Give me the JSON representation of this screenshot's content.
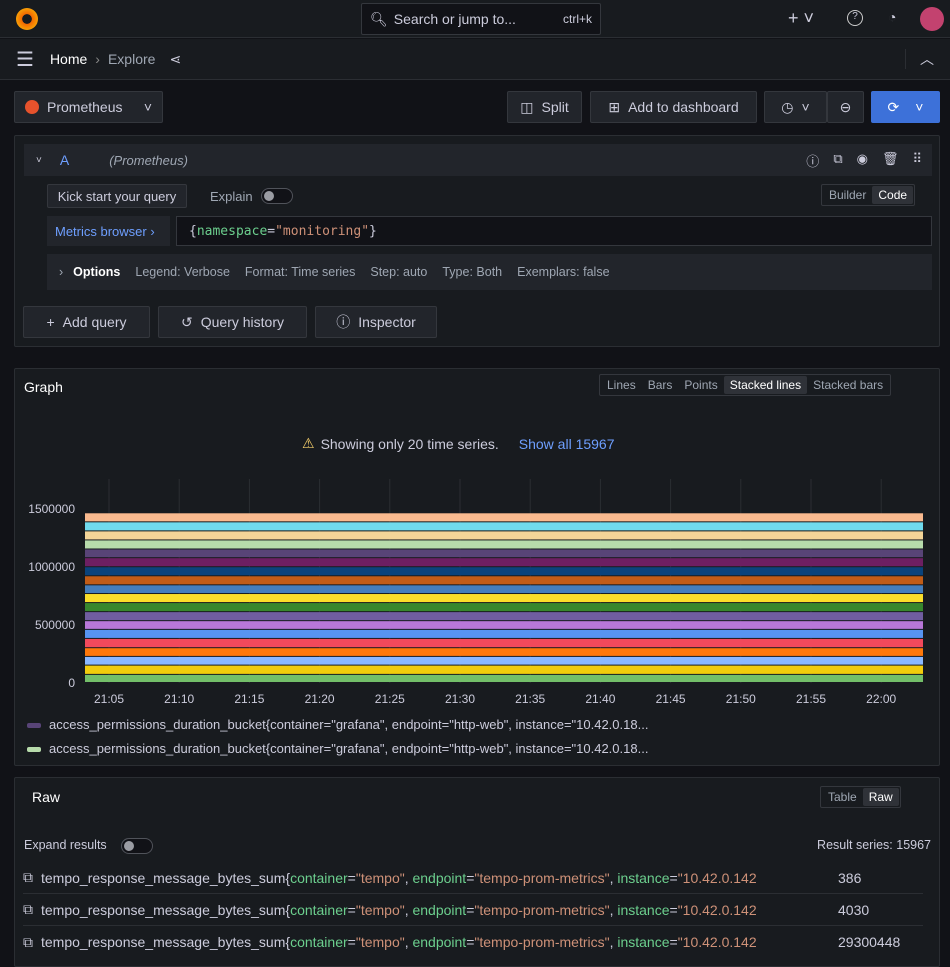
{
  "topbar": {
    "search_placeholder": "Search or jump to...",
    "shortcut": "ctrl+k"
  },
  "breadcrumb": {
    "home": "Home",
    "current": "Explore"
  },
  "toolbar": {
    "datasource": "Prometheus",
    "split": "Split",
    "add_to_dashboard": "Add to dashboard"
  },
  "query": {
    "ref": "A",
    "datasource": "(Prometheus)",
    "kick_start": "Kick start your query",
    "explain": "Explain",
    "builder": "Builder",
    "code": "Code",
    "metrics_browser": "Metrics browser",
    "expr_open": "{",
    "expr_key": "namespace",
    "expr_eq": "=",
    "expr_val": "\"monitoring\"",
    "expr_close": "}",
    "options": {
      "label": "Options",
      "legend": "Legend: Verbose",
      "format": "Format: Time series",
      "step": "Step: auto",
      "type": "Type: Both",
      "exemplars": "Exemplars: false"
    }
  },
  "actions": {
    "add_query": "Add query",
    "query_history": "Query history",
    "inspector": "Inspector"
  },
  "graph": {
    "title": "Graph",
    "modes": [
      "Lines",
      "Bars",
      "Points",
      "Stacked lines",
      "Stacked bars"
    ],
    "active_mode": "Stacked lines",
    "warning": "Showing only 20 time series.",
    "show_all": "Show all 15967",
    "legend": [
      "access_permissions_duration_bucket{container=\"grafana\", endpoint=\"http-web\", instance=\"10.42.0.18...",
      "access_permissions_duration_bucket{container=\"grafana\", endpoint=\"http-web\", instance=\"10.42.0.18..."
    ],
    "legend_colors": [
      "#584477",
      "#b7dbab"
    ]
  },
  "chart_data": {
    "type": "area",
    "stacked": true,
    "yticks": [
      "0",
      "500000",
      "1000000",
      "1500000"
    ],
    "ylim": [
      0,
      1500000
    ],
    "xticks": [
      "21:05",
      "21:10",
      "21:15",
      "21:20",
      "21:25",
      "21:30",
      "21:35",
      "21:40",
      "21:45",
      "21:50",
      "21:55",
      "22:00"
    ],
    "series_colors": [
      "#73bf69",
      "#f2cc0c",
      "#8ab8ff",
      "#ff780a",
      "#f2495c",
      "#5794f2",
      "#b877d9",
      "#705da0",
      "#37872d",
      "#fade2a",
      "#447ebc",
      "#c15c17",
      "#0a437c",
      "#6d1f62",
      "#584477",
      "#b7dbab",
      "#f4d598",
      "#70dbed",
      "#f9ba8f"
    ],
    "series_values": [
      70000,
      80000,
      75000,
      75000,
      80000,
      78000,
      75000,
      78000,
      78000,
      78000,
      75000,
      78000,
      78000,
      78000,
      75000,
      78000,
      78000,
      78000,
      78000
    ]
  },
  "raw": {
    "title": "Raw",
    "table": "Table",
    "raw": "Raw",
    "expand": "Expand results",
    "result_series": "Result series: 15967",
    "rows": [
      {
        "metric": "tempo_response_message_bytes_sum",
        "value": "386"
      },
      {
        "metric": "tempo_response_message_bytes_sum",
        "value": "4030"
      },
      {
        "metric": "tempo_response_message_bytes_sum",
        "value": "29300448"
      }
    ],
    "labels": {
      "k1": "container",
      "v1": "\"tempo\"",
      "k2": "endpoint",
      "v2": "\"tempo-prom-metrics\"",
      "k3": "instance",
      "v3": "\"10.42.0.142"
    }
  }
}
